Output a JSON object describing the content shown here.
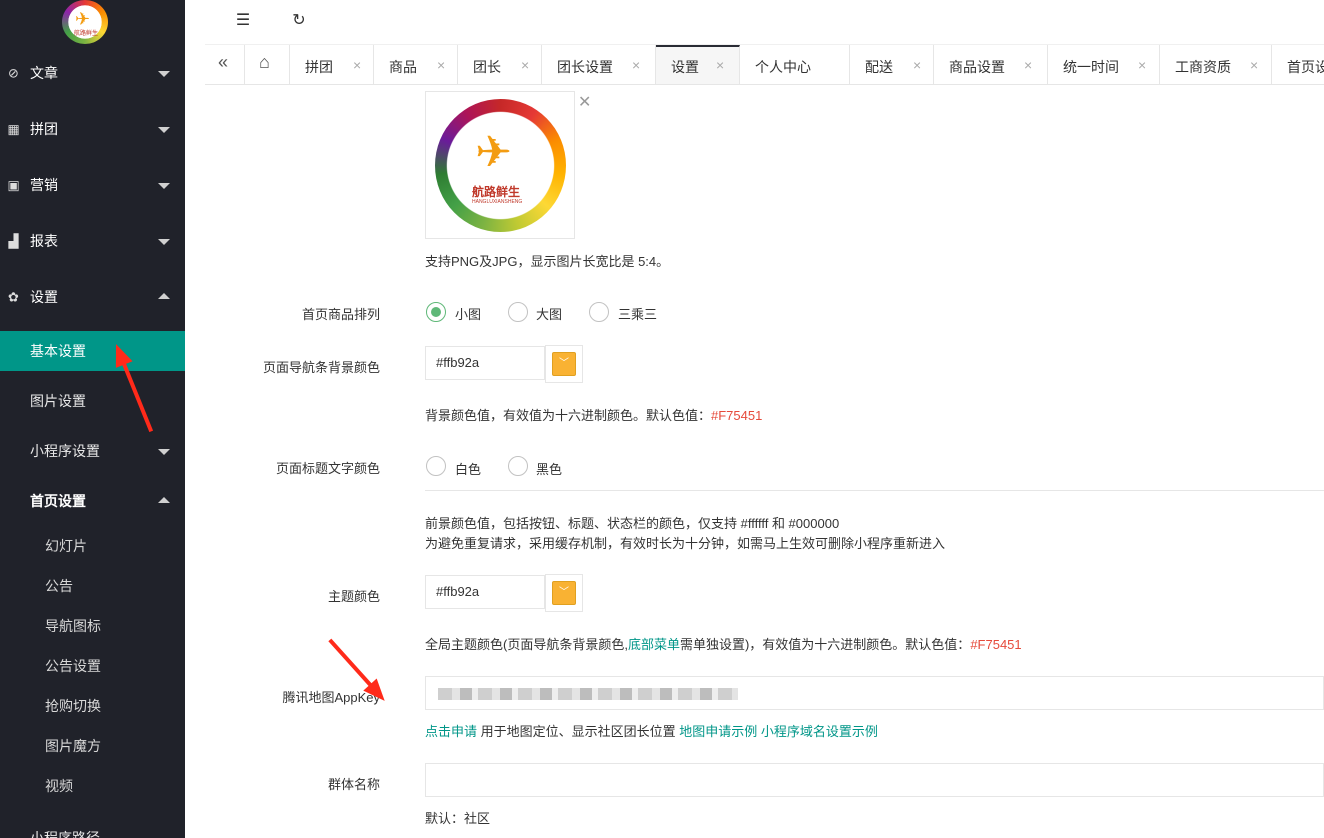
{
  "sidebar": {
    "logo_text": "航路鲜生",
    "menus": [
      {
        "label": "文章",
        "icon": "compass-icon"
      },
      {
        "label": "拼团",
        "icon": "grid-icon"
      },
      {
        "label": "营销",
        "icon": "gift-icon"
      },
      {
        "label": "报表",
        "icon": "chart-icon"
      },
      {
        "label": "设置",
        "icon": "gear-icon"
      }
    ],
    "settings_sub": [
      {
        "label": "基本设置"
      },
      {
        "label": "图片设置"
      },
      {
        "label": "小程序设置"
      },
      {
        "label": "首页设置"
      }
    ],
    "home_sub": [
      "幻灯片",
      "公告",
      "导航图标",
      "公告设置",
      "抢购切换",
      "图片魔方",
      "视频"
    ],
    "cut_item": "小程序路径"
  },
  "topbar": {
    "collapse_icon": "indent-icon",
    "refresh_icon": "refresh-icon"
  },
  "tabs": [
    {
      "label": "拼团"
    },
    {
      "label": "商品"
    },
    {
      "label": "团长"
    },
    {
      "label": "团长设置"
    },
    {
      "label": "设置"
    },
    {
      "label": "个人中心"
    },
    {
      "label": "配送"
    },
    {
      "label": "商品设置"
    },
    {
      "label": "统一时间"
    },
    {
      "label": "工商资质"
    },
    {
      "label": "首页设"
    }
  ],
  "form": {
    "logo_text": "航路鲜生",
    "logo_sub": "HANGLUXIANSHENG",
    "image_hint": "支持PNG及JPG，显示图片长宽比是 5:4。",
    "goods_layout": {
      "label": "首页商品排列",
      "options": [
        "小图",
        "大图",
        "三乘三"
      ],
      "selected": "小图"
    },
    "nav_bg": {
      "label": "页面导航条背景颜色",
      "value": "#ffb92a",
      "hint": "背景颜色值，有效值为十六进制颜色。默认色值：",
      "default": "#F75451",
      "swatch": "#f9b233"
    },
    "title_color": {
      "label": "页面标题文字颜色",
      "options": [
        "白色",
        "黑色"
      ],
      "hint1": "前景颜色值，包括按钮、标题、状态栏的颜色，仅支持 #ffffff 和 #000000",
      "hint2": "为避免重复请求，采用缓存机制，有效时长为十分钟，如需马上生效可删除小程序重新进入"
    },
    "theme": {
      "label": "主题颜色",
      "value": "#ffb92a",
      "hint_a": "全局主题颜色(页面导航条背景颜色,",
      "hint_link": "底部菜单",
      "hint_b": "需单独设置)，有效值为十六进制颜色。默认色值：",
      "default": "#F75451"
    },
    "map_key": {
      "label": "腾讯地图AppKey",
      "apply": "点击申请",
      "desc": " 用于地图定位、显示社区团长位置 ",
      "link1": "地图申请示例",
      "link2": "小程序域名设置示例"
    },
    "group_name": {
      "label": "群体名称",
      "value": "",
      "hint": "默认：社区"
    }
  }
}
